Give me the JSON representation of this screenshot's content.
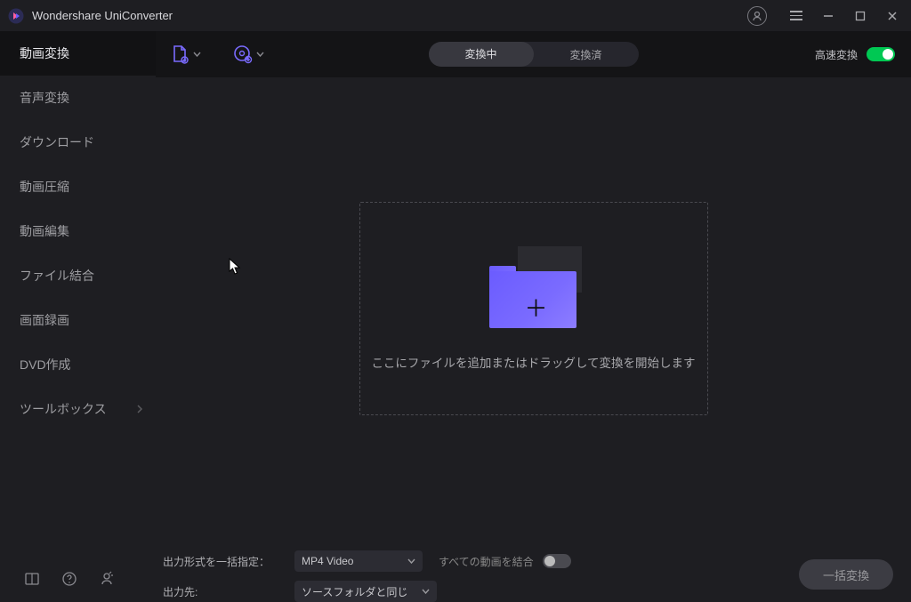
{
  "app": {
    "title": "Wondershare UniConverter"
  },
  "sidebar": {
    "items": [
      {
        "label": "動画変換",
        "name": "sidebar-item-video-convert"
      },
      {
        "label": "音声変換",
        "name": "sidebar-item-audio-convert"
      },
      {
        "label": "ダウンロード",
        "name": "sidebar-item-download"
      },
      {
        "label": "動画圧縮",
        "name": "sidebar-item-compress"
      },
      {
        "label": "動画編集",
        "name": "sidebar-item-edit"
      },
      {
        "label": "ファイル結合",
        "name": "sidebar-item-merge"
      },
      {
        "label": "画面録画",
        "name": "sidebar-item-record"
      },
      {
        "label": "DVD作成",
        "name": "sidebar-item-dvd"
      },
      {
        "label": "ツールボックス",
        "name": "sidebar-item-toolbox"
      }
    ]
  },
  "topbar": {
    "tab_converting": "変換中",
    "tab_converted": "変換済",
    "high_speed_label": "高速変換"
  },
  "drop": {
    "text": "ここにファイルを追加またはドラッグして変換を開始します"
  },
  "bottom": {
    "format_label": "出力形式を一括指定：",
    "format_value": "MP4 Video",
    "dest_label": "出力先:",
    "dest_value": "ソースフォルダと同じ",
    "merge_label": "すべての動画を結合",
    "convert_button": "一括変換"
  }
}
